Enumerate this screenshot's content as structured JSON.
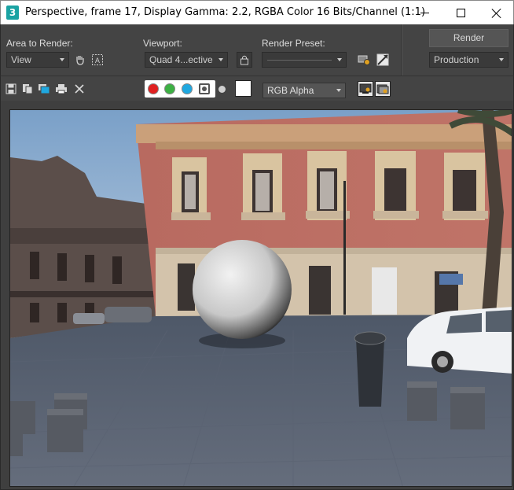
{
  "window": {
    "app_icon_glyph": "3",
    "title": "Perspective, frame 17, Display Gamma: 2.2, RGBA Color 16 Bits/Channel (1:1)",
    "controls": [
      "minimize-icon",
      "maximize-icon",
      "close-icon"
    ]
  },
  "settings": {
    "area_label": "Area to Render:",
    "area_value": "View",
    "viewport_label": "Viewport:",
    "viewport_value": "Quad 4...ective",
    "preset_label": "Render Preset:",
    "preset_value": "",
    "render_button": "Render",
    "production_value": "Production",
    "icons": [
      "hand-icon",
      "region-select-icon",
      "lock-icon",
      "render-setup-icon",
      "environment-icon"
    ]
  },
  "toolbar": {
    "icons": [
      "save-icon",
      "copy-icon",
      "clone-icon",
      "print-icon",
      "clear-icon"
    ],
    "channels": [
      {
        "name": "red",
        "color": "#e02020"
      },
      {
        "name": "green",
        "color": "#3cb043"
      },
      {
        "name": "blue",
        "color": "#1fa8e0"
      },
      {
        "name": "alpha",
        "color": "#6a6a6a"
      }
    ],
    "channel_display": "RGB Alpha",
    "right_icons": [
      "show-frame-window-icon",
      "frame-history-icon"
    ]
  },
  "colors": {
    "panel_bg": "#444444",
    "title_bg": "#ffffff"
  }
}
